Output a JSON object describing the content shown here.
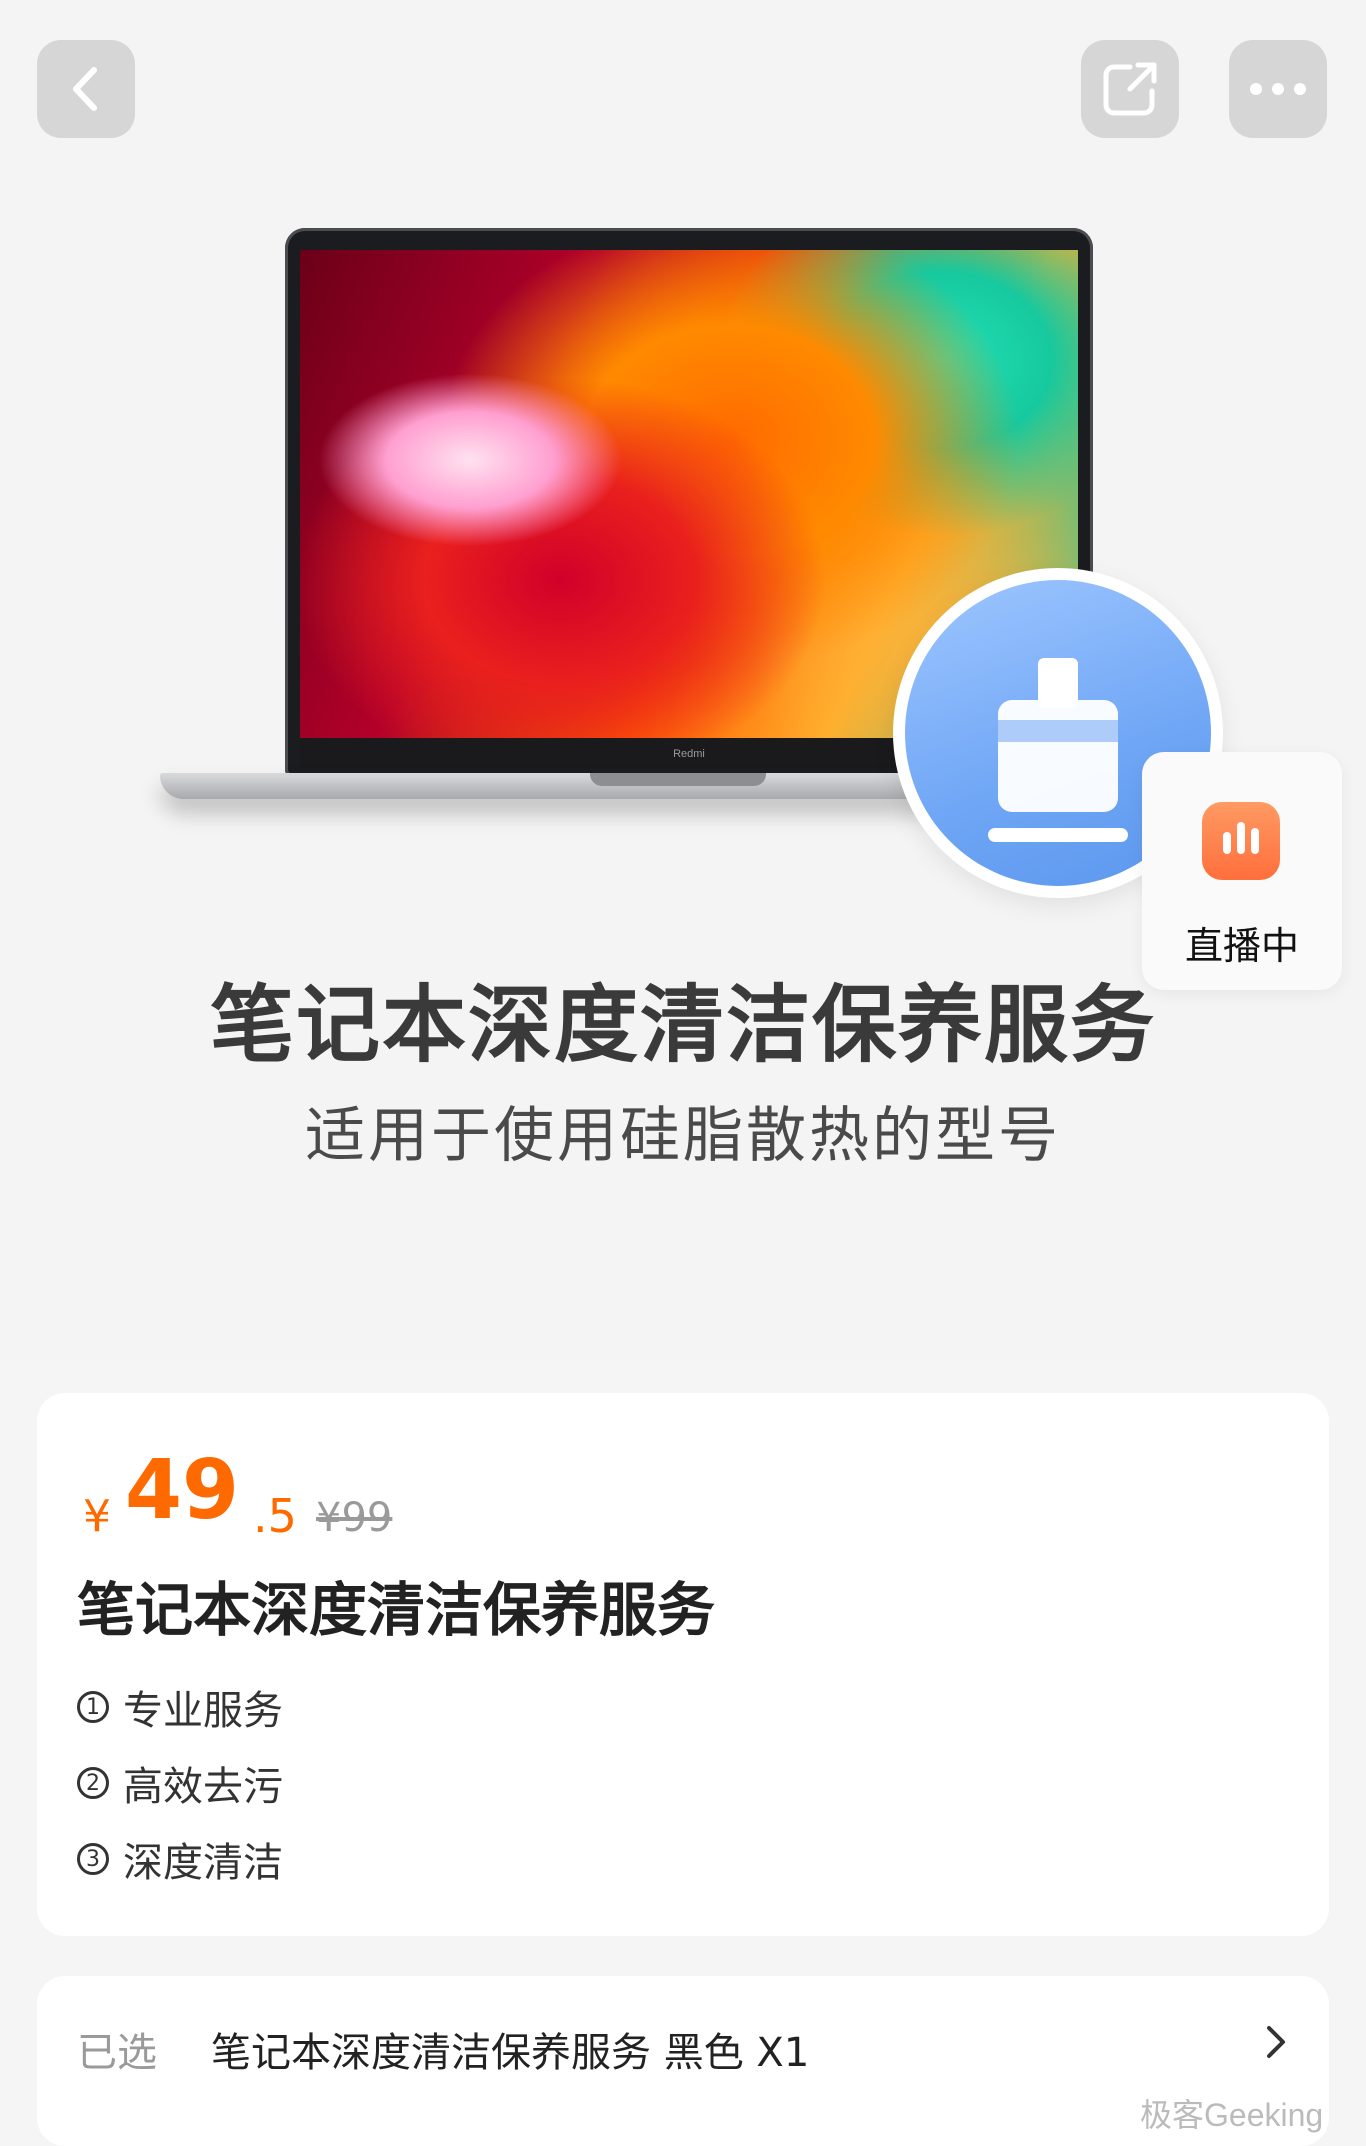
{
  "topbar": {
    "back_icon": "chevron-left-icon",
    "share_icon": "share-icon",
    "more_icon": "more-dots-icon"
  },
  "hero": {
    "laptop_brand": "Redmi",
    "title": "笔记本深度清洁保养服务",
    "subtitle": "适用于使用硅脂散热的型号",
    "badge_icon": "cleaning-brush-icon"
  },
  "live": {
    "label": "直播中",
    "icon": "live-bars-icon",
    "accent": "#ff7a45"
  },
  "product": {
    "currency": "¥",
    "price_int": "49",
    "price_dec": ".5",
    "original_price": "¥99",
    "title": "笔记本深度清洁保养服务",
    "features": [
      {
        "num": "1",
        "text": "专业服务"
      },
      {
        "num": "2",
        "text": "高效去污"
      },
      {
        "num": "3",
        "text": "深度清洁"
      }
    ],
    "price_color": "#ff6a00"
  },
  "selection": {
    "label": "已选",
    "value": "笔记本深度清洁保养服务 黑色 X1"
  },
  "watermark": "极客Geeking"
}
